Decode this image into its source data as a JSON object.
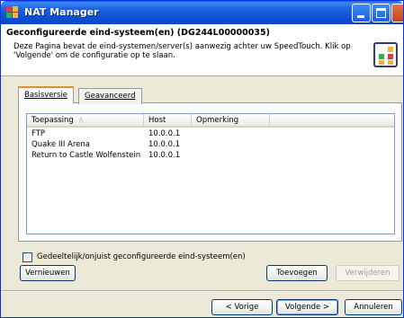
{
  "window": {
    "title": "NAT Manager"
  },
  "header": {
    "title": "Geconfigureerde eind-systeem(en) (DG244L00000035)",
    "description": "Deze Pagina bevat de eind-systemen/server(s) aanwezig achter uw SpeedTouch. Klik op 'Volgende' om de configuratie op te slaan."
  },
  "tabs": [
    {
      "label": "Basisversie",
      "selected": true
    },
    {
      "label": "Geavanceerd",
      "selected": false
    }
  ],
  "list": {
    "columns": [
      "Toepassing",
      "Host",
      "Opmerking"
    ],
    "rows": [
      {
        "app": "FTP",
        "host": "10.0.0.1",
        "remark": ""
      },
      {
        "app": "Quake III Arena",
        "host": "10.0.0.1",
        "remark": ""
      },
      {
        "app": "Return to Castle Wolfenstein",
        "host": "10.0.0.1",
        "remark": ""
      }
    ]
  },
  "checkbox": {
    "label": "Gedeeltelijk/onjuist geconfigureerde eind-systeem(en)",
    "checked": false
  },
  "buttons": {
    "refresh": "Vernieuwen",
    "add": "Toevoegen",
    "remove": "Verwijderen",
    "previous": "< Vorige",
    "next": "Volgende >",
    "cancel": "Annuleren"
  },
  "colors": {
    "titlebar": "#0d47c4",
    "tab_highlight": "#e68b2c",
    "button_border": "#003c74"
  }
}
